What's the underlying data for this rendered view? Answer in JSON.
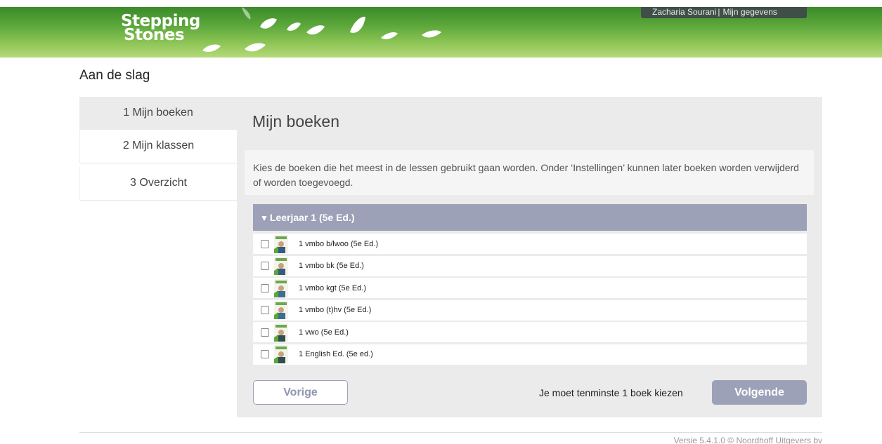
{
  "header": {
    "logo_line1": "Stepping",
    "logo_line2": "Stones",
    "user_name": "Zacharia Sourani",
    "my_details": "Mijn gegevens"
  },
  "page_title": "Aan de slag",
  "steps": [
    {
      "label": "1 Mijn boeken",
      "active": true
    },
    {
      "label": "2 Mijn klassen",
      "active": false
    },
    {
      "label": "3 Overzicht",
      "active": false
    }
  ],
  "main": {
    "title": "Mijn boeken",
    "intro": "Kies de boeken die het meest in de lessen gebruikt gaan worden. Onder ‘Instellingen’ kunnen later boeken worden verwijderd of worden toegevoegd.",
    "group_title": "Leerjaar 1 (5e Ed.)",
    "books": [
      {
        "label": "1 vmbo b/lwoo (5e Ed.)",
        "checked": false
      },
      {
        "label": "1 vmbo bk (5e Ed.)",
        "checked": false
      },
      {
        "label": "1 vmbo kgt (5e Ed.)",
        "checked": false
      },
      {
        "label": "1 vmbo (t)hv (5e Ed.)",
        "checked": false
      },
      {
        "label": "1 vwo (5e Ed.)",
        "checked": false
      },
      {
        "label": "1 English Ed. (5e ed.)",
        "checked": false
      }
    ],
    "prev_label": "Vorige",
    "hint": "Je moet tenminste 1 boek kiezen",
    "next_label": "Volgende"
  },
  "footer": {
    "version": "Versie 5.4.1.0 © Noordhoff Uitgevers bv"
  },
  "colors": {
    "header_green": "#5aa63a",
    "group_header": "#9ca1b8",
    "panel_bg": "#ebebeb"
  }
}
